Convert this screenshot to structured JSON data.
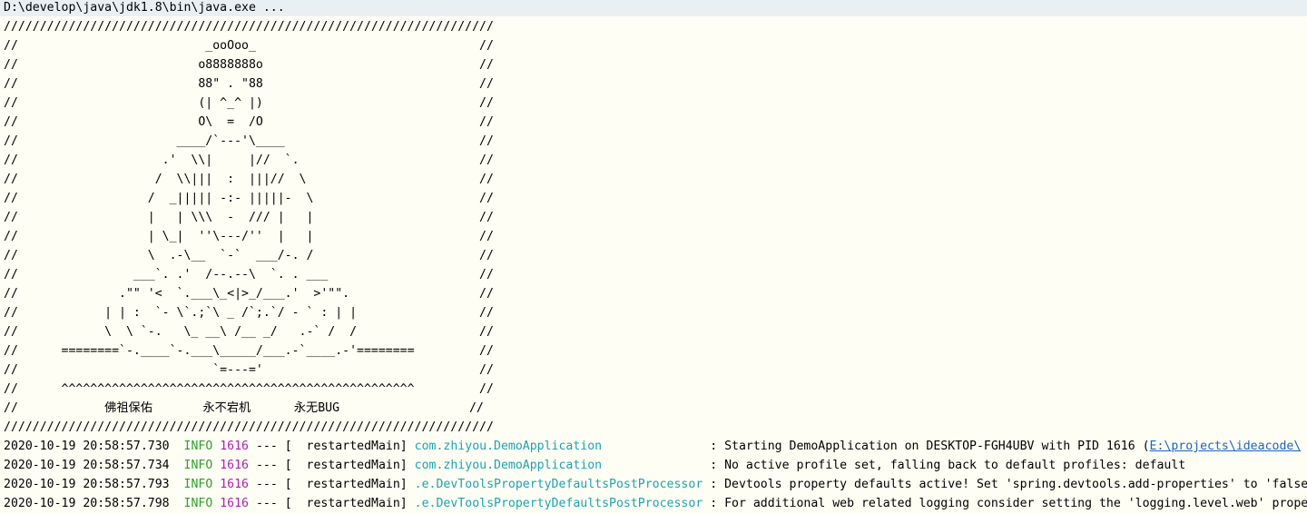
{
  "command_line": "D:\\develop\\java\\jdk1.8\\bin\\java.exe ...",
  "banner_lines": [
    "////////////////////////////////////////////////////////////////////",
    "//                          _ooOoo_                               //",
    "//                         o8888888o                              //",
    "//                         88\" . \"88                              //",
    "//                         (| ^_^ |)                              //",
    "//                         O\\  =  /O                              //",
    "//                      ____/`---'\\____                           //",
    "//                    .'  \\\\|     |//  `.                         //",
    "//                   /  \\\\|||  :  |||//  \\                        //",
    "//                  /  _||||| -:- |||||-  \\                       //",
    "//                  |   | \\\\\\  -  /// |   |                       //",
    "//                  | \\_|  ''\\---/''  |   |                       //",
    "//                  \\  .-\\__  `-`  ___/-. /                       //",
    "//                ___`. .'  /--.--\\  `. . ___                     //",
    "//              .\"\" '<  `.___\\_<|>_/___.'  >'\"\".                  //",
    "//            | | :  `- \\`.;`\\ _ /`;.`/ - ` : | |                 //",
    "//            \\  \\ `-.   \\_ __\\ /__ _/   .-` /  /                 //",
    "//      ========`-.____`-.___\\_____/___.-`____.-'========         //",
    "//                           `=---='                              //",
    "//      ^^^^^^^^^^^^^^^^^^^^^^^^^^^^^^^^^^^^^^^^^^^^^^^^^         //",
    "//            佛祖保佑       永不宕机      永无BUG                  //",
    "////////////////////////////////////////////////////////////////////"
  ],
  "log_lines": [
    {
      "timestamp": "2020-10-19 20:58:57.730",
      "level": "INFO",
      "pid": "1616",
      "separator": "---",
      "thread": "[  restartedMain]",
      "logger": "com.zhiyou.DemoApplication              ",
      "message": ": Starting DemoApplication on DESKTOP-FGH4UBV with PID 1616 (",
      "link": "E:\\projects\\ideacode\\"
    },
    {
      "timestamp": "2020-10-19 20:58:57.734",
      "level": "INFO",
      "pid": "1616",
      "separator": "---",
      "thread": "[  restartedMain]",
      "logger": "com.zhiyou.DemoApplication              ",
      "message": ": No active profile set, falling back to default profiles: default",
      "link": ""
    },
    {
      "timestamp": "2020-10-19 20:58:57.793",
      "level": "INFO",
      "pid": "1616",
      "separator": "---",
      "thread": "[  restartedMain]",
      "logger": ".e.DevToolsPropertyDefaultsPostProcessor",
      "message": ": Devtools property defaults active! Set 'spring.devtools.add-properties' to 'false' to disable",
      "link": ""
    },
    {
      "timestamp": "2020-10-19 20:58:57.798",
      "level": "INFO",
      "pid": "1616",
      "separator": "---",
      "thread": "[  restartedMain]",
      "logger": ".e.DevToolsPropertyDefaultsPostProcessor",
      "message": ": For additional web related logging consider setting the 'logging.level.web' property to 'DEBUG'",
      "link": ""
    }
  ]
}
